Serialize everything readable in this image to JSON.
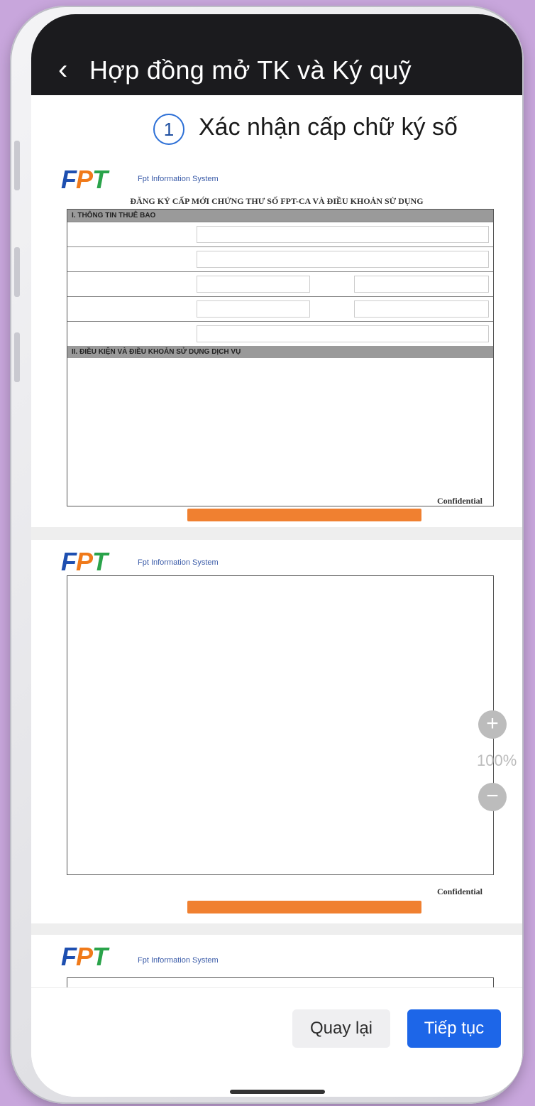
{
  "header": {
    "back_icon": "chevron-left-icon",
    "title": "Hợp đồng mở TK và Ký quỹ"
  },
  "step": {
    "number": "1",
    "label": "Xác nhận cấp chữ ký số"
  },
  "document": {
    "pages": [
      {
        "logo": "FPT",
        "system": "Fpt Information System",
        "title": "ĐĂNG KÝ CẤP MỚI CHỨNG THƯ SỐ FPT-CA VÀ ĐIỀU KHOẢN SỬ DỤNG",
        "section1": "I. THÔNG TIN THUÊ BAO",
        "section2": "II. ĐIỀU KIỆN VÀ ĐIỀU KHOẢN SỬ DỤNG DỊCH VỤ",
        "confidential": "Confidential"
      },
      {
        "logo": "FPT",
        "system": "Fpt Information System",
        "confidential": "Confidential"
      },
      {
        "logo": "FPT",
        "system": "Fpt Information System"
      }
    ]
  },
  "zoom": {
    "plus_icon": "plus-icon",
    "minus_icon": "minus-icon",
    "level": "100%"
  },
  "actions": {
    "back_label": "Quay lại",
    "next_label": "Tiếp tục"
  },
  "colors": {
    "header_bg": "#1b1b1e",
    "primary": "#1d66e8",
    "page_bg": "#c8a6dc",
    "accent_orange": "#f08030"
  }
}
